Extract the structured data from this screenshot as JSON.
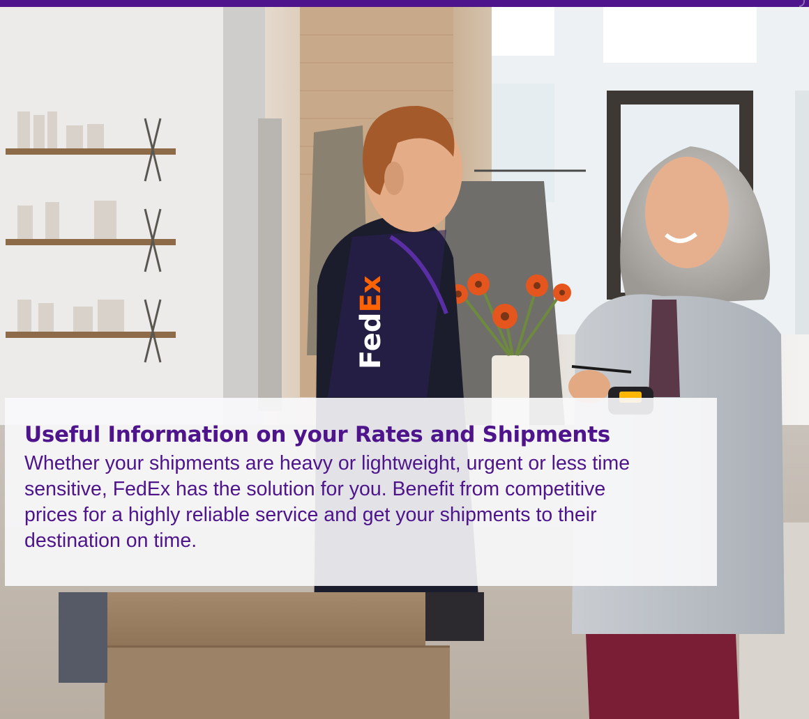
{
  "colors": {
    "brand_purple": "#4d148c",
    "brand_orange": "#ff6200"
  },
  "hero": {
    "image_alt": "FedEx courier delivering package to smiling woman in a boutique",
    "uniform_logo": "FedEx"
  },
  "info_card": {
    "title": "Useful Information on your Rates and Shipments",
    "body": "Whether your shipments are heavy or lightweight, urgent or less time sensitive, FedEx has the solution for you. Benefit from competitive prices for a highly reliable service and get your shipments to their destination on time."
  }
}
